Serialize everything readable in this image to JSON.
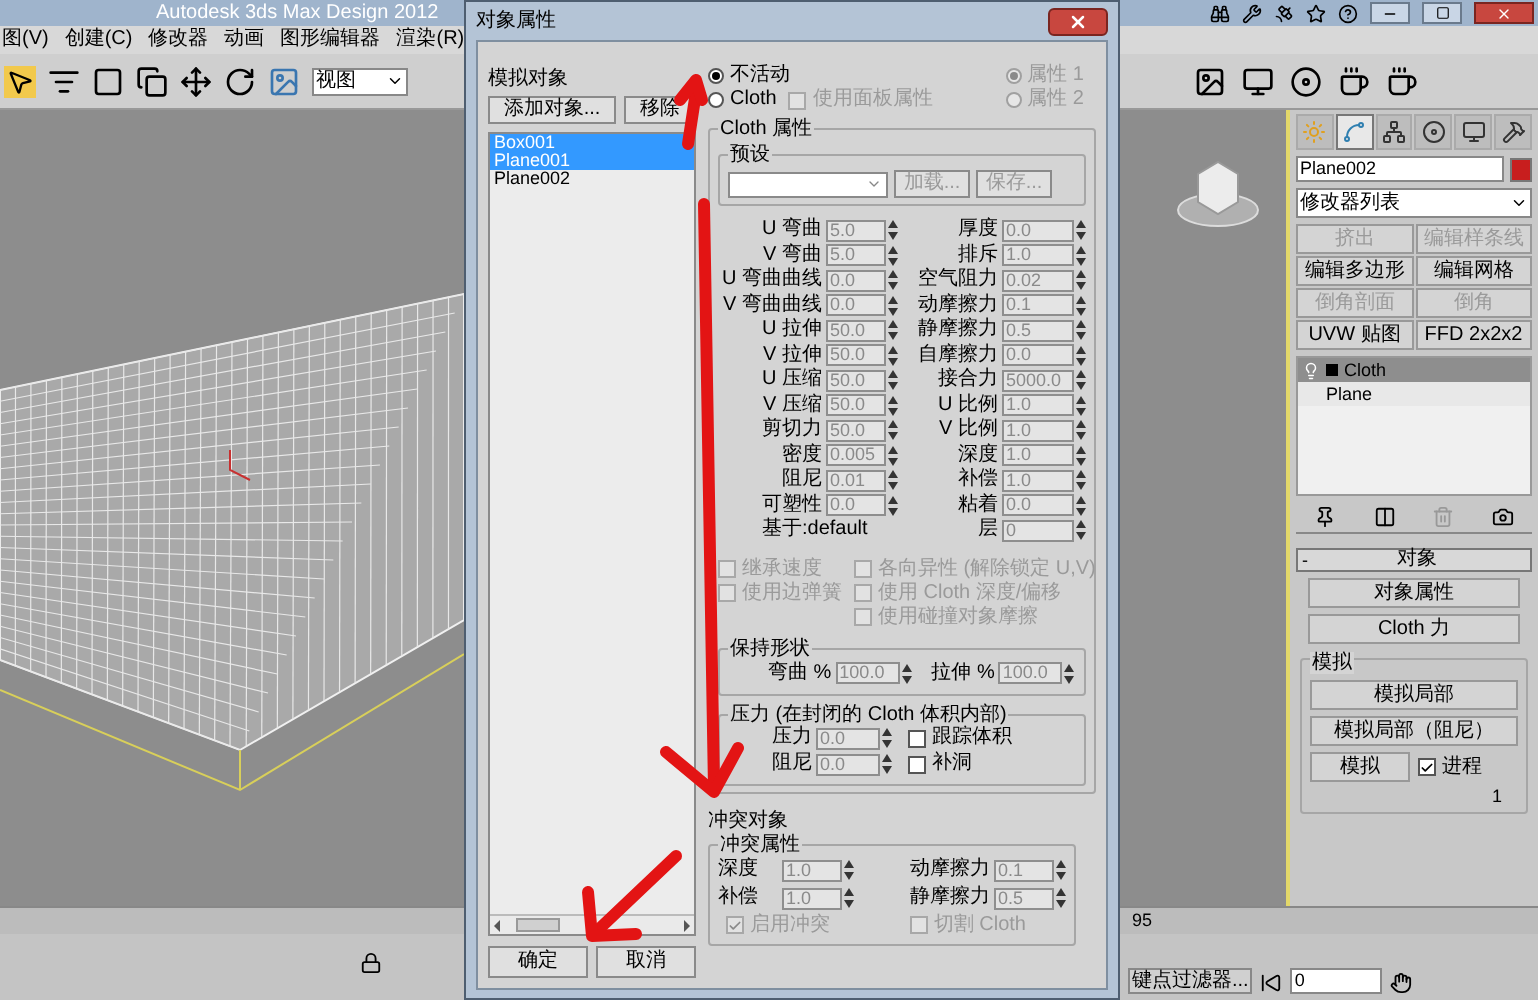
{
  "app_title": "Autodesk 3ds Max Design 2012",
  "menu": [
    "图(V)",
    "创建(C)",
    "修改器",
    "动画",
    "图形编辑器",
    "渲染(R)"
  ],
  "toolbar": {
    "view_dropdown": "视图"
  },
  "dialog": {
    "title": "对象属性",
    "sim_objects": {
      "label": "模拟对象",
      "add_button": "添加对象...",
      "remove_button": "移除",
      "items": [
        {
          "name": "Box001",
          "selected": true
        },
        {
          "name": "Plane001",
          "selected": true
        },
        {
          "name": "Plane002",
          "selected": false
        }
      ]
    },
    "ok": "确定",
    "cancel": "取消",
    "mode_options": [
      {
        "label": "不活动",
        "selected": true
      },
      {
        "label": "Cloth",
        "selected": false
      }
    ],
    "use_panel_props": {
      "label": "使用面板属性",
      "checked": false,
      "disabled": true
    },
    "property_options": [
      {
        "label": "属性 1",
        "selected": true,
        "disabled": true
      },
      {
        "label": "属性 2",
        "selected": false,
        "disabled": true
      }
    ],
    "cloth_props": {
      "title": "Cloth 属性",
      "preset": {
        "title": "预设",
        "load": "加载...",
        "save": "保存..."
      },
      "left_params": [
        {
          "label": "U 弯曲",
          "value": "5.0"
        },
        {
          "label": "V 弯曲",
          "value": "5.0"
        },
        {
          "label": "U 弯曲曲线",
          "value": "0.0"
        },
        {
          "label": "V 弯曲曲线",
          "value": "0.0"
        },
        {
          "label": "U 拉伸",
          "value": "50.0"
        },
        {
          "label": "V 拉伸",
          "value": "50.0"
        },
        {
          "label": "U 压缩",
          "value": "50.0"
        },
        {
          "label": "V 压缩",
          "value": "50.0"
        },
        {
          "label": "剪切力",
          "value": "50.0"
        },
        {
          "label": "密度",
          "value": "0.005"
        },
        {
          "label": "阻尼",
          "value": "0.01"
        },
        {
          "label": "可塑性",
          "value": "0.0"
        }
      ],
      "based_on": "基于:default",
      "right_params": [
        {
          "label": "厚度",
          "value": "0.0"
        },
        {
          "label": "排斥",
          "value": "1.0"
        },
        {
          "label": "空气阻力",
          "value": "0.02"
        },
        {
          "label": "动摩擦力",
          "value": "0.1"
        },
        {
          "label": "静摩擦力",
          "value": "0.5"
        },
        {
          "label": "自摩擦力",
          "value": "0.0"
        },
        {
          "label": "接合力",
          "value": "5000.0"
        },
        {
          "label": "U 比例",
          "value": "1.0"
        },
        {
          "label": "V 比例",
          "value": "1.0"
        },
        {
          "label": "深度",
          "value": "1.0"
        },
        {
          "label": "补偿",
          "value": "1.0"
        },
        {
          "label": "粘着",
          "value": "0.0"
        },
        {
          "label": "层",
          "value": "0"
        }
      ],
      "options_left": [
        {
          "label": "继承速度",
          "checked": false,
          "disabled": true
        },
        {
          "label": "使用边弹簧",
          "checked": false,
          "disabled": true
        }
      ],
      "options_right": [
        {
          "label": "各向异性 (解除锁定 U,V)",
          "checked": false,
          "disabled": true
        },
        {
          "label": "使用 Cloth 深度/偏移",
          "checked": false,
          "disabled": true
        },
        {
          "label": "使用碰撞对象摩擦",
          "checked": false,
          "disabled": true
        }
      ],
      "keep_shape": {
        "title": "保持形状",
        "fields": [
          {
            "label": "弯曲 %",
            "value": "100.0"
          },
          {
            "label": "拉伸 %",
            "value": "100.0"
          }
        ]
      },
      "pressure": {
        "title": "压力 (在封闭的 Cloth 体积内部)",
        "fields": [
          {
            "label": "压力",
            "value": "0.0"
          },
          {
            "label": "阻尼",
            "value": "0.0"
          }
        ],
        "options": [
          {
            "label": "跟踪体积",
            "checked": false,
            "disabled": false
          },
          {
            "label": "补洞",
            "checked": false,
            "disabled": false
          }
        ]
      }
    },
    "collision_object": "冲突对象",
    "collision_props": {
      "title": "冲突属性",
      "left_fields": [
        {
          "label": "深度",
          "value": "1.0"
        },
        {
          "label": "补偿",
          "value": "1.0"
        }
      ],
      "right_fields": [
        {
          "label": "动摩擦力",
          "value": "0.1"
        },
        {
          "label": "静摩擦力",
          "value": "0.5"
        }
      ],
      "options": [
        {
          "label": "启用冲突",
          "checked": true,
          "disabled": true
        },
        {
          "label": "切割 Cloth",
          "checked": false,
          "disabled": true
        }
      ]
    }
  },
  "command_panel": {
    "tabs": [
      {
        "kind": "create",
        "selected": false
      },
      {
        "kind": "modify",
        "selected": true
      },
      {
        "kind": "hierarchy",
        "selected": false
      },
      {
        "kind": "motion",
        "selected": false
      },
      {
        "kind": "display",
        "selected": false
      },
      {
        "kind": "utilities",
        "selected": false
      }
    ],
    "object_name": "Plane002",
    "modifier_list": "修改器列表",
    "modifier_buttons": [
      {
        "label": "挤出",
        "disabled": true
      },
      {
        "label": "编辑样条线",
        "disabled": true
      },
      {
        "label": "编辑多边形",
        "disabled": false
      },
      {
        "label": "编辑网格",
        "disabled": false
      },
      {
        "label": "倒角剖面",
        "disabled": true
      },
      {
        "label": "倒角",
        "disabled": true
      },
      {
        "label": "UVW 贴图",
        "disabled": false
      },
      {
        "label": "FFD 2x2x2",
        "disabled": false
      }
    ],
    "stack": [
      {
        "label": "Cloth",
        "selected": true
      },
      {
        "label": "Plane",
        "selected": false
      }
    ],
    "rollout": {
      "toggle": "-",
      "title": "对象"
    },
    "object_buttons": [
      "对象属性",
      "Cloth 力"
    ],
    "simulate": {
      "title": "模拟",
      "buttons": [
        "模拟局部",
        "模拟局部（阻尼）"
      ],
      "simulate_button": "模拟",
      "progress": {
        "label": "进程",
        "checked": true
      },
      "value": "1"
    }
  },
  "timeline": {
    "frame_tick": "95",
    "key_filter": "键点过滤器...",
    "current_frame": "0"
  }
}
